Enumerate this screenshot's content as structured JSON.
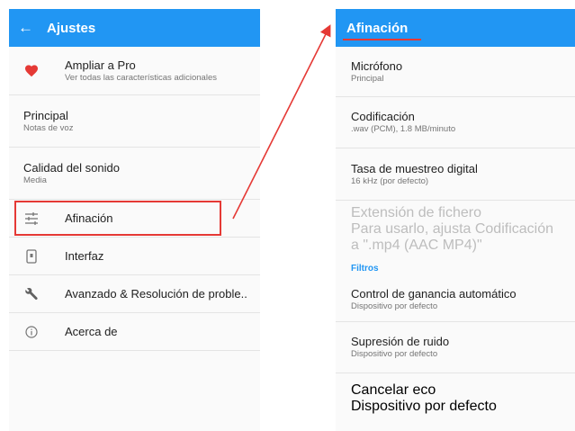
{
  "left": {
    "title": "Ajustes",
    "pro": {
      "title": "Ampliar a Pro",
      "subtitle": "Ver todas las características adicionales"
    },
    "principal": {
      "title": "Principal",
      "subtitle": "Notas de voz"
    },
    "calidad": {
      "title": "Calidad del sonido",
      "subtitle": "Media"
    },
    "menu": [
      "Afinación",
      "Interfaz",
      "Avanzado & Resolución de proble..",
      "Acerca de"
    ]
  },
  "right": {
    "title": "Afinación",
    "items": [
      {
        "title": "Micrófono",
        "subtitle": "Principal"
      },
      {
        "title": "Codificación",
        "subtitle": ".wav (PCM), 1.8 MB/minuto"
      },
      {
        "title": "Tasa de muestreo digital",
        "subtitle": "16 kHz (por defecto)"
      },
      {
        "title": "Extensión de fichero",
        "subtitle": "Para usarlo, ajusta Codificación a \".mp4 (AAC MP4)\""
      }
    ],
    "category": "Filtros",
    "filters": [
      {
        "title": "Control de ganancia automático",
        "subtitle": "Dispositivo por defecto"
      },
      {
        "title": "Supresión de ruido",
        "subtitle": "Dispositivo por defecto"
      },
      {
        "title": "Cancelar eco",
        "subtitle": "Dispositivo por defecto"
      }
    ]
  },
  "colors": {
    "appbar": "#2196f3",
    "annotation": "#e53935",
    "heart": "#e53935"
  },
  "icons": [
    "back-arrow-icon",
    "heart-icon",
    "tune-icon",
    "phone-icon",
    "wrench-icon",
    "info-icon"
  ]
}
